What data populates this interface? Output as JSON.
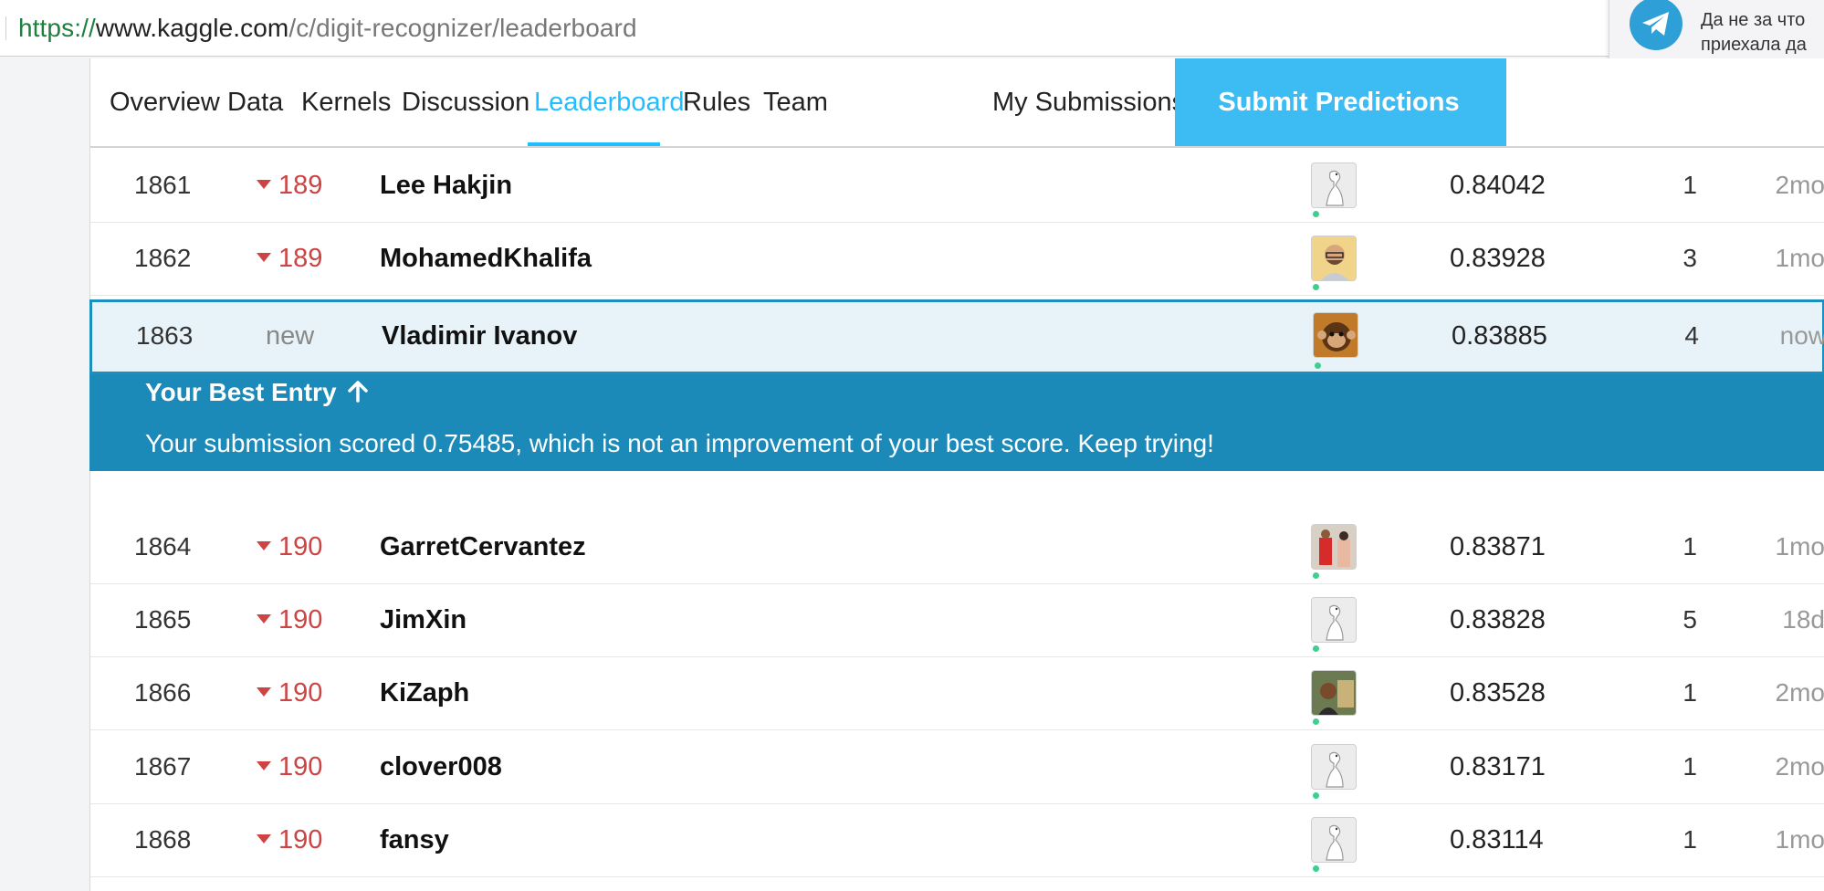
{
  "browser": {
    "url_scheme": "https://",
    "url_host": "www.kaggle.com",
    "url_path": "/c/digit-recognizer/leaderboard"
  },
  "notification": {
    "app_icon": "telegram-icon",
    "line1": "Да не за что",
    "line2": "приехала да"
  },
  "nav": {
    "tabs": [
      {
        "label": "Overview"
      },
      {
        "label": "Data"
      },
      {
        "label": "Kernels"
      },
      {
        "label": "Discussion"
      },
      {
        "label": "Leaderboard",
        "active": true
      },
      {
        "label": "Rules"
      },
      {
        "label": "Team"
      }
    ],
    "my_submissions": "My Submissions",
    "submit_button": "Submit Predictions",
    "accent": "#20beff"
  },
  "leaderboard": {
    "rows": [
      {
        "rank": "1861",
        "delta": "189",
        "name": "Lee Hakjin",
        "avatar": "default-goose-avatar",
        "score": "0.84042",
        "entries": "1",
        "last": "2mo"
      },
      {
        "rank": "1862",
        "delta": "189",
        "name": "MohamedKhalifa",
        "avatar": "photo-avatar",
        "score": "0.83928",
        "entries": "3",
        "last": "1mo"
      },
      {
        "rank": "1863",
        "delta": "new",
        "name": "Vladimir Ivanov",
        "avatar": "monkey-avatar",
        "score": "0.83885",
        "entries": "4",
        "last": "now",
        "is_current_user": true
      },
      {
        "rank": "1864",
        "delta": "190",
        "name": "GarretCervantez",
        "avatar": "photo-avatar",
        "score": "0.83871",
        "entries": "1",
        "last": "1mo"
      },
      {
        "rank": "1865",
        "delta": "190",
        "name": "JimXin",
        "avatar": "default-goose-avatar",
        "score": "0.83828",
        "entries": "5",
        "last": "18d"
      },
      {
        "rank": "1866",
        "delta": "190",
        "name": "KiZaph",
        "avatar": "photo-avatar",
        "score": "0.83528",
        "entries": "1",
        "last": "2mo"
      },
      {
        "rank": "1867",
        "delta": "190",
        "name": "clover008",
        "avatar": "default-goose-avatar",
        "score": "0.83171",
        "entries": "1",
        "last": "2mo"
      },
      {
        "rank": "1868",
        "delta": "190",
        "name": "fansy",
        "avatar": "default-goose-avatar",
        "score": "0.83114",
        "entries": "1",
        "last": "1mo"
      }
    ]
  },
  "best_entry": {
    "title": "Your Best Entry",
    "icon": "arrow-up-icon",
    "message": "Your submission scored 0.75485, which is not an improvement of your best score. Keep trying!",
    "color": "#1b8ab8"
  }
}
